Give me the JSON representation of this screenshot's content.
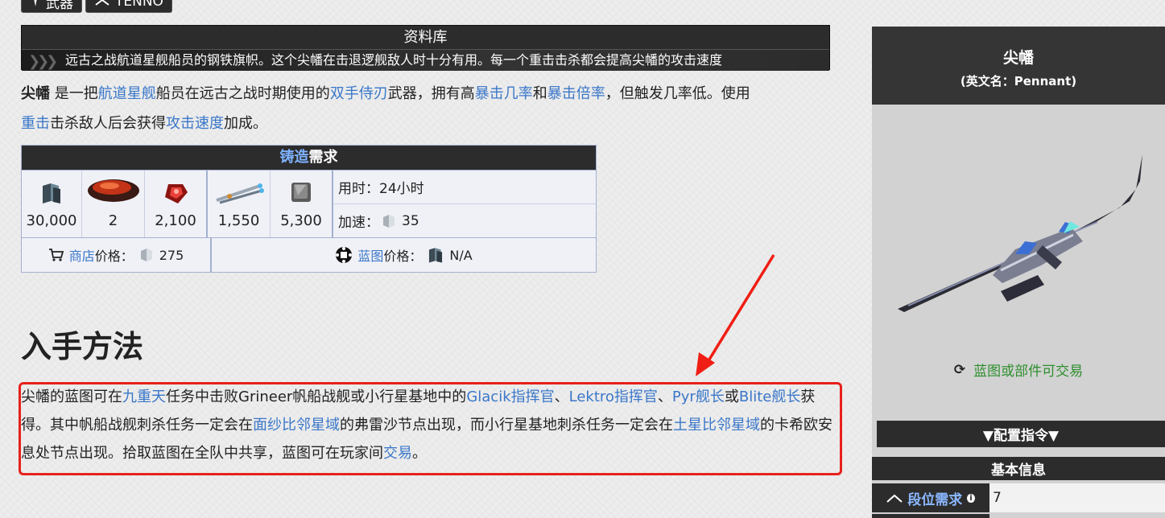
{
  "tags": [
    {
      "label": "武器",
      "icon": "weapon-icon"
    },
    {
      "label": "TENNO",
      "icon": "tenno-icon"
    }
  ],
  "database": {
    "title": "资料库",
    "description": "远古之战航道星舰船员的钢铁旗帜。这个尖幡在击退逻舰敌人时十分有用。每一个重击击杀都会提高尖幡的攻击速度"
  },
  "intro": {
    "name": "尖幡",
    "t1": " 是一把",
    "l1": "航道星舰",
    "t2": "船员在远古之战时期使用的",
    "l2": "双手侍刃",
    "t3": "武器，拥有高",
    "l3": "暴击几率",
    "t4": "和",
    "l4": "暴击倍率",
    "t5": "，但触发几率低。使用",
    "l5": "重击",
    "t6": "击杀敌人后会获得",
    "l6": "攻击速度",
    "t7": "加成。"
  },
  "crafting": {
    "header_link": "铸造",
    "header_text": "需求",
    "resources": [
      {
        "icon": "credits-icon",
        "amount": "30,000"
      },
      {
        "icon": "orokin-cell-icon",
        "amount": "2"
      },
      {
        "icon": "red-gem-icon",
        "amount": "2,100"
      },
      {
        "icon": "circuits-icon",
        "amount": "1,550"
      },
      {
        "icon": "ferrite-icon",
        "amount": "5,300"
      }
    ],
    "time_label": "用时：24小时",
    "rush_label": "加速：",
    "rush_value": "35",
    "shop_link": "商店",
    "shop_label": "价格：",
    "shop_value": "275",
    "bp_link": "蓝图",
    "bp_label": "价格：",
    "bp_value": "N/A"
  },
  "acquisition": {
    "heading": "入手方法",
    "t1": "尖幡的蓝图可在",
    "l1": "九重天",
    "t2": "任务中击败Grineer帆船战舰或小行星基地中的",
    "l2": "Glacik指挥官",
    "t3": "、",
    "l3": "Lektro指挥官",
    "t4": "、",
    "l4": "Pyr舰长",
    "t5": "或",
    "l5": "Blite舰长",
    "t6": "获得。其中帆船战舰刺杀任务一定会在",
    "l6": "面纱比邻星域",
    "t7": "的弗雷沙节点出现，而小行星基地刺杀任务一定会在",
    "l7": "土星比邻星域",
    "t8": "的卡希欧安息处节点出现。拾取蓝图在全队中共享，蓝图可在玩家间",
    "l8": "交易",
    "t9": "。"
  },
  "infobox": {
    "title": "尖幡",
    "subtitle": "(英文名：Pennant)",
    "trade_text": "蓝图或部件可交易",
    "config_label": "▼配置指令▼",
    "basic_label": "基本信息",
    "rank_label": "段位需求",
    "rank_value": "7"
  },
  "colors": {
    "link": "#3a77c9",
    "highlight_border": "#e8201a",
    "dark_panel": "#2c2c2c",
    "trade_green": "#2e8f2e"
  }
}
